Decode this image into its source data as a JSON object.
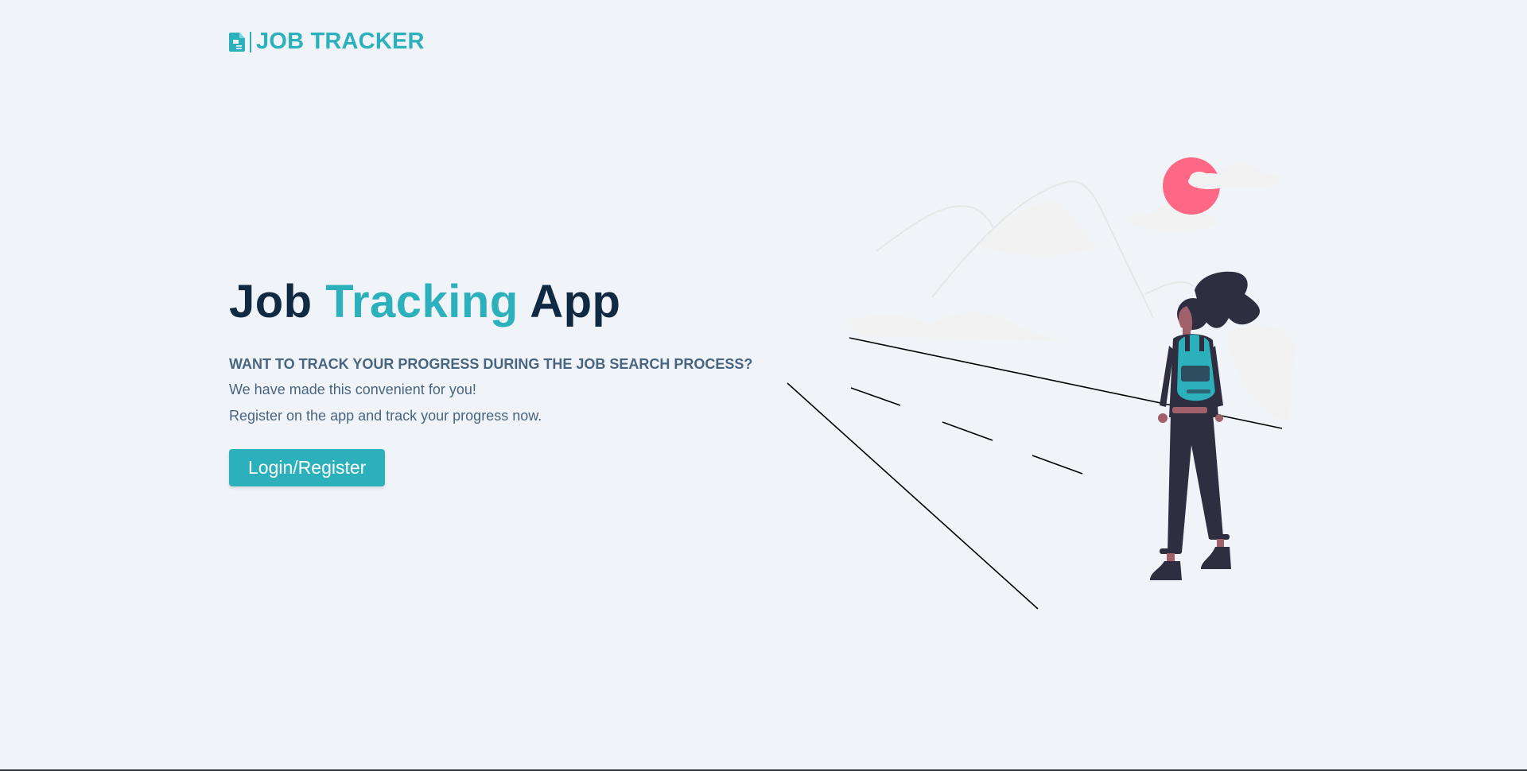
{
  "brand": {
    "logo_text": "JOB TRACKER",
    "accent_color": "#2cb1bc",
    "icon": "document-icon"
  },
  "hero": {
    "title_part1": "Job ",
    "title_accent": "Tracking",
    "title_part2": " App",
    "tagline": "WANT TO TRACK YOUR PROGRESS DURING THE JOB SEARCH PROCESS?",
    "line1": "We have made this convenient for you!",
    "line2": "Register on the app and track your progress now.",
    "cta_label": "Login/Register"
  },
  "colors": {
    "background": "#f0f4f8",
    "heading": "#102a43",
    "body_text": "#486581",
    "sun": "#ff6884",
    "figure_dark": "#2f2e41",
    "skin": "#a0616a"
  }
}
